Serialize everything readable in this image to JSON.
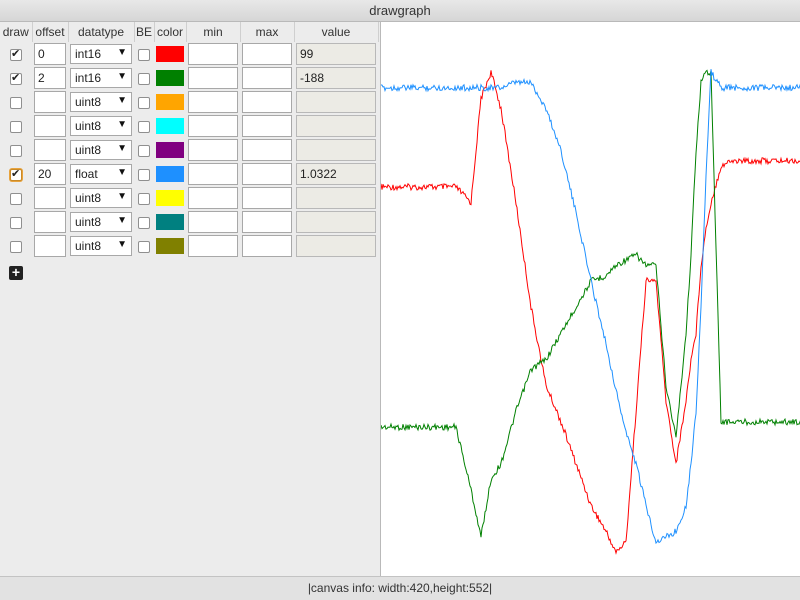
{
  "window": {
    "title": "drawgraph"
  },
  "table": {
    "headers": {
      "draw": "draw",
      "offset": "offset",
      "datatype": "datatype",
      "be": "BE",
      "color": "color",
      "min": "min",
      "max": "max",
      "value": "value"
    },
    "rows": [
      {
        "draw": true,
        "offset": "0",
        "datatype": "int16",
        "be": false,
        "color": "#ff0000",
        "min": "",
        "max": "",
        "value": "99"
      },
      {
        "draw": true,
        "offset": "2",
        "datatype": "int16",
        "be": false,
        "color": "#008000",
        "min": "",
        "max": "",
        "value": "-188"
      },
      {
        "draw": false,
        "offset": "",
        "datatype": "uint8",
        "be": false,
        "color": "#ffa500",
        "min": "",
        "max": "",
        "value": ""
      },
      {
        "draw": false,
        "offset": "",
        "datatype": "uint8",
        "be": false,
        "color": "#00ffff",
        "min": "",
        "max": "",
        "value": ""
      },
      {
        "draw": false,
        "offset": "",
        "datatype": "uint8",
        "be": false,
        "color": "#800080",
        "min": "",
        "max": "",
        "value": ""
      },
      {
        "draw": true,
        "offset": "20",
        "datatype": "float",
        "be": false,
        "color": "#1e90ff",
        "min": "",
        "max": "",
        "value": "1.0322"
      },
      {
        "draw": false,
        "offset": "",
        "datatype": "uint8",
        "be": false,
        "color": "#ffff00",
        "min": "",
        "max": "",
        "value": ""
      },
      {
        "draw": false,
        "offset": "",
        "datatype": "uint8",
        "be": false,
        "color": "#008080",
        "min": "",
        "max": "",
        "value": ""
      },
      {
        "draw": false,
        "offset": "",
        "datatype": "uint8",
        "be": false,
        "color": "#808000",
        "min": "",
        "max": "",
        "value": ""
      }
    ],
    "add_icon": "plus-icon"
  },
  "status": {
    "text": "|canvas info: width:420,height:552|"
  },
  "chart_data": {
    "type": "line",
    "x": [
      0,
      40,
      75,
      90,
      100,
      110,
      120,
      135,
      150,
      165,
      180,
      195,
      210,
      225,
      235,
      245,
      255,
      265,
      275,
      285,
      295,
      305,
      310,
      315,
      320,
      325,
      330,
      340,
      350,
      356,
      365,
      375,
      380,
      420
    ],
    "series": [
      {
        "color": "#ff0000",
        "values": [
          0.27,
          0.27,
          0.27,
          0.3,
          0.1,
          0.05,
          0.12,
          0.3,
          0.5,
          0.65,
          0.72,
          0.8,
          0.88,
          0.93,
          0.97,
          0.95,
          0.7,
          0.45,
          0.45,
          0.68,
          0.8,
          0.68,
          0.6,
          0.55,
          0.42,
          0.35,
          0.3,
          0.23,
          0.22,
          0.22,
          0.22,
          0.22,
          0.22,
          0.22
        ]
      },
      {
        "color": "#008000",
        "values": [
          0.73,
          0.73,
          0.73,
          0.85,
          0.94,
          0.83,
          0.8,
          0.7,
          0.62,
          0.6,
          0.55,
          0.5,
          0.45,
          0.44,
          0.42,
          0.41,
          0.4,
          0.42,
          0.42,
          0.65,
          0.75,
          0.55,
          0.4,
          0.2,
          0.07,
          0.05,
          0.05,
          0.72,
          0.72,
          0.72,
          0.72,
          0.72,
          0.72,
          0.72
        ]
      },
      {
        "color": "#1e90ff",
        "values": [
          0.08,
          0.08,
          0.08,
          0.08,
          0.08,
          0.08,
          0.08,
          0.07,
          0.07,
          0.12,
          0.2,
          0.32,
          0.45,
          0.57,
          0.66,
          0.74,
          0.8,
          0.88,
          0.95,
          0.94,
          0.93,
          0.88,
          0.8,
          0.7,
          0.5,
          0.25,
          0.05,
          0.08,
          0.08,
          0.08,
          0.08,
          0.08,
          0.08,
          0.08
        ]
      }
    ]
  }
}
